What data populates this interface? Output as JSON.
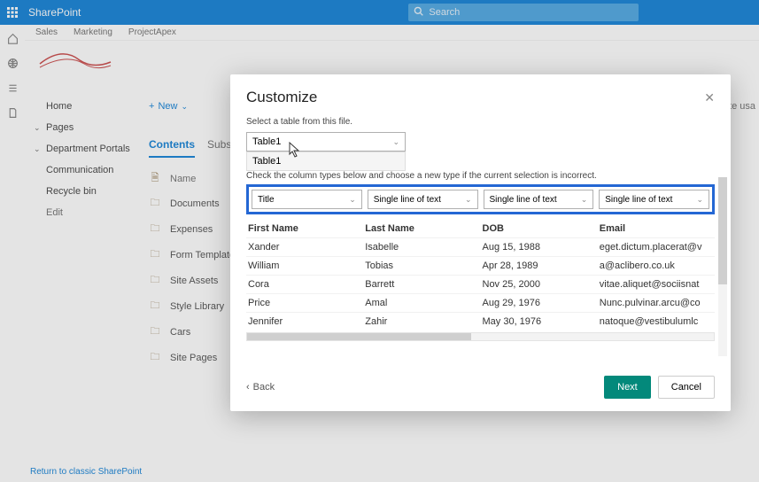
{
  "topbar": {
    "brand": "SharePoint",
    "search_placeholder": "Search"
  },
  "tabs": {
    "sales": "Sales",
    "marketing": "Marketing",
    "projectapex": "ProjectApex"
  },
  "sidenav": {
    "home": "Home",
    "pages": "Pages",
    "department_portals": "Department Portals",
    "communication": "Communication",
    "recycle": "Recycle bin",
    "edit": "Edit"
  },
  "toolbar": {
    "new": "New"
  },
  "content_tabs": {
    "contents": "Contents",
    "subsites": "Subsites"
  },
  "filelist": {
    "name_header": "Name",
    "items": [
      {
        "label": "Documents"
      },
      {
        "label": "Expenses"
      },
      {
        "label": "Form Templates"
      },
      {
        "label": "Site Assets"
      },
      {
        "label": "Style Library"
      },
      {
        "label": "Cars"
      },
      {
        "label": "Site Pages"
      }
    ]
  },
  "rightlabel": "Site usa",
  "return_link": "Return to classic SharePoint",
  "modal": {
    "title": "Customize",
    "select_label": "Select a table from this file.",
    "selected_table": "Table1",
    "dropdown_option": "Table1",
    "instruction": "Check the column types below and choose a new type if the current selection is incorrect.",
    "type_selectors": [
      "Title",
      "Single line of text",
      "Single line of text",
      "Single line of text"
    ],
    "headers": [
      "First Name",
      "Last Name",
      "DOB",
      "Email"
    ],
    "rows": [
      {
        "first": "Xander",
        "last": "Isabelle",
        "dob": "Aug 15, 1988",
        "email": "eget.dictum.placerat@v"
      },
      {
        "first": "William",
        "last": "Tobias",
        "dob": "Apr 28, 1989",
        "email": "a@aclibero.co.uk"
      },
      {
        "first": "Cora",
        "last": "Barrett",
        "dob": "Nov 25, 2000",
        "email": "vitae.aliquet@sociisnat"
      },
      {
        "first": "Price",
        "last": "Amal",
        "dob": "Aug 29, 1976",
        "email": "Nunc.pulvinar.arcu@co"
      },
      {
        "first": "Jennifer",
        "last": "Zahir",
        "dob": "May 30, 1976",
        "email": "natoque@vestibulumlc"
      }
    ],
    "back": "Back",
    "next": "Next",
    "cancel": "Cancel"
  }
}
